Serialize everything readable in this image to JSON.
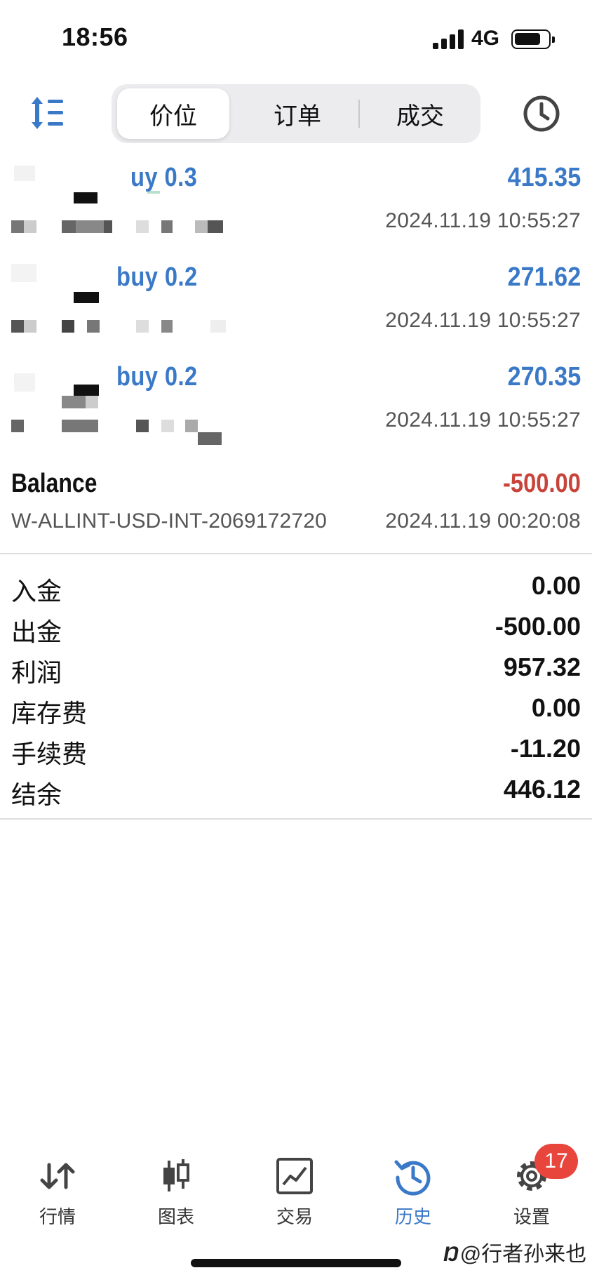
{
  "status_bar": {
    "time": "18:56",
    "network": "4G"
  },
  "toolbar": {
    "tabs": [
      {
        "label": "价位",
        "active": true
      },
      {
        "label": "订单",
        "active": false
      },
      {
        "label": "成交",
        "active": false
      }
    ],
    "left_icon": "sort-icon",
    "right_icon": "clock-history-icon"
  },
  "deals": [
    {
      "action": "uy 0.3",
      "profit": "415.35",
      "time": "2024.11.19 10:55:27"
    },
    {
      "action": "buy 0.2",
      "profit": "271.62",
      "time": "2024.11.19 10:55:27"
    },
    {
      "action": "buy 0.2",
      "profit": "270.35",
      "time": "2024.11.19 10:55:27"
    }
  ],
  "balance": {
    "label": "Balance",
    "amount": "-500.00",
    "comment": "W-ALLINT-USD-INT-2069172720",
    "time": "2024.11.19 00:20:08"
  },
  "summary": [
    {
      "label": "入金",
      "value": "0.00"
    },
    {
      "label": "出金",
      "value": "-500.00"
    },
    {
      "label": "利润",
      "value": "957.32"
    },
    {
      "label": "库存费",
      "value": "0.00"
    },
    {
      "label": "手续费",
      "value": "-11.20"
    },
    {
      "label": "结余",
      "value": "446.12"
    }
  ],
  "nav": [
    {
      "label": "行情",
      "icon": "quotes-arrows-icon",
      "active": false
    },
    {
      "label": "图表",
      "icon": "candlestick-icon",
      "active": false
    },
    {
      "label": "交易",
      "icon": "trade-chart-icon",
      "active": false
    },
    {
      "label": "历史",
      "icon": "history-icon",
      "active": true
    },
    {
      "label": "设置",
      "icon": "settings-gear-icon",
      "active": false
    }
  ],
  "settings_badge": "17",
  "watermark": {
    "logo": "Ŋ",
    "text": "@行者孙来也"
  },
  "colors": {
    "accent": "#3a79c8",
    "negative": "#c8443a",
    "text": "#111111",
    "muted": "#555555"
  }
}
